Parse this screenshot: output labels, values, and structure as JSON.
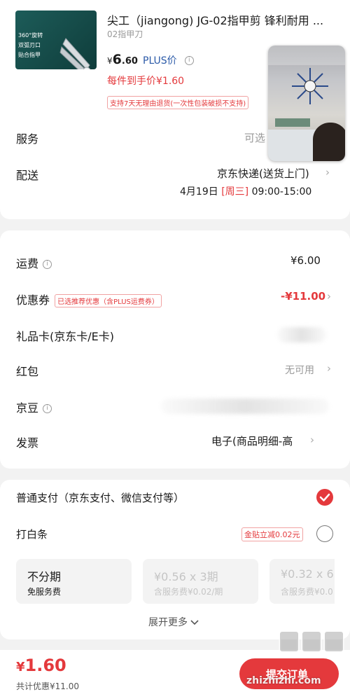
{
  "product": {
    "thumb_lines": [
      "360°旋转",
      "双弧刃口",
      "贴合指甲"
    ],
    "title": "尖工（jiangong) JG-02指甲剪 锋利耐用 ...",
    "subtitle": "02指甲刀",
    "price_symbol": "¥",
    "price_int": "6",
    "price_dec": ".60",
    "plus_label": "PLUS价",
    "final_price": "每件到手价¥1.60",
    "return_policy": "支持7天无理由退货(一次性包装破损不支持)"
  },
  "service": {
    "label": "服务",
    "value": "可选"
  },
  "delivery": {
    "label": "配送",
    "value": "京东快递(送货上门)",
    "date": "4月19日",
    "weekday": "[周三]",
    "time": "09:00-15:00"
  },
  "fees": {
    "shipping_label": "运费",
    "shipping_value": "¥6.00",
    "coupon_label": "优惠券",
    "coupon_tag": "已选推荐优惠（含PLUS运费券）",
    "coupon_value": "-¥11.00",
    "giftcard_label": "礼品卡(京东卡/E卡)",
    "redpacket_label": "红包",
    "redpacket_value": "无可用",
    "jingdou_label": "京豆",
    "invoice_label": "发票",
    "invoice_value": "电子(商品明细-高"
  },
  "payment": {
    "normal_label": "普通支付（京东支付、微信支付等）",
    "baitiao_label": "打白条",
    "baitiao_tag": "金贴立减0.02元",
    "plans": [
      {
        "title": "不分期",
        "sub": "免服务费"
      },
      {
        "title": "¥0.56 x 3期",
        "sub": "含服务费¥0.02/期"
      },
      {
        "title": "¥0.32 x 6",
        "sub": "含服务费¥0.0"
      }
    ],
    "expand": "展开更多"
  },
  "footer": {
    "total_symbol": "¥",
    "total_value": "1.60",
    "discount_total": "共计优惠¥11.00",
    "submit": "提交订单",
    "watermark": "zhizhizhi.com"
  },
  "colors": {
    "accent": "#e4393c",
    "plus": "#2b5aa8",
    "background": "#f2f2f2"
  },
  "icons": [
    "info-icon",
    "chevron-right-icon",
    "check-icon",
    "chevron-down-icon"
  ]
}
